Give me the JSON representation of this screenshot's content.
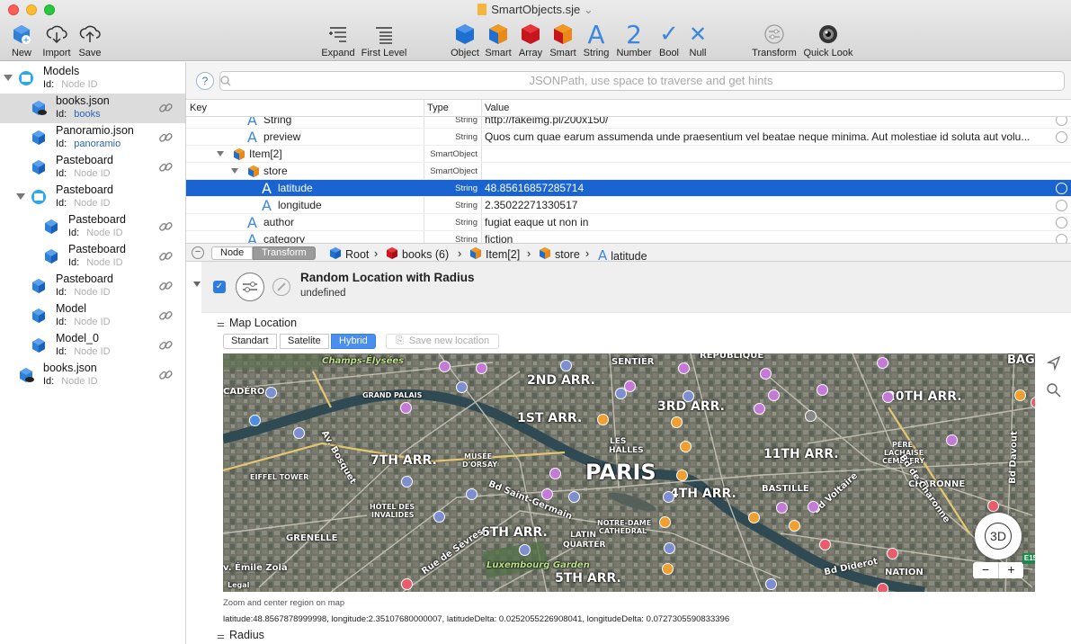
{
  "window": {
    "title": "SmartObjects.sje",
    "title_chevron": "⌄"
  },
  "toolbar": {
    "new": "New",
    "import": "Import",
    "save": "Save",
    "expand": "Expand",
    "first_level": "First Level",
    "object": "Object",
    "smart": "Smart",
    "array": "Array",
    "smart2": "Smart",
    "string": "String",
    "number": "Number",
    "bool": "Bool",
    "null": "Null",
    "transform": "Transform",
    "quick_look": "Quick Look",
    "string_glyph": "A",
    "number_glyph": "2",
    "bool_glyph": "✓",
    "null_glyph": "✕"
  },
  "sidebar": {
    "id_label": "Id:",
    "items": [
      {
        "name": "Models",
        "id": "Node ID",
        "level": 0,
        "icon": "folder-icon",
        "expanded": true,
        "link": false
      },
      {
        "name": "books.json",
        "id": "books",
        "level": 1,
        "icon": "cloud-cube-icon",
        "selected": true,
        "link": true,
        "id_is_value": true
      },
      {
        "name": "Panoramio.json",
        "id": "panoramio",
        "level": 1,
        "icon": "cube-icon",
        "link": true,
        "id_is_value": true
      },
      {
        "name": "Pasteboard",
        "id": "Node ID",
        "level": 1,
        "icon": "cube-icon",
        "link": true
      },
      {
        "name": "Pasteboard",
        "id": "Node ID",
        "level": 1,
        "icon": "folder-icon",
        "expanded": true,
        "link": false
      },
      {
        "name": "Pasteboard",
        "id": "Node ID",
        "level": 2,
        "icon": "cube-icon",
        "link": true
      },
      {
        "name": "Pasteboard",
        "id": "Node ID",
        "level": 2,
        "icon": "cube-icon",
        "link": true
      },
      {
        "name": "Pasteboard",
        "id": "Node ID",
        "level": 1,
        "icon": "cube-icon",
        "link": true
      },
      {
        "name": "Model",
        "id": "Node ID",
        "level": 1,
        "icon": "cube-icon",
        "link": true
      },
      {
        "name": "Model_0",
        "id": "Node ID",
        "level": 1,
        "icon": "cube-icon",
        "link": true
      },
      {
        "name": "books.json",
        "id": "Node ID",
        "level": 0,
        "icon": "cloud-cube-icon",
        "link": true
      }
    ]
  },
  "search": {
    "placeholder": "JSONPath, use space to traverse and get hints",
    "help": "?"
  },
  "table": {
    "headers": {
      "key": "Key",
      "type": "Type",
      "value": "Value"
    },
    "rows": [
      {
        "key": "String",
        "type": "String",
        "value": "http://fakeimg.pl/200x150/",
        "icon": "string-icon",
        "level": 2
      },
      {
        "key": "preview",
        "type": "String",
        "value": "Quos cum quae earum assumenda unde praesentium vel beatae neque minima. Aut molestiae id soluta aut volu...",
        "icon": "string-icon",
        "level": 2
      },
      {
        "key": "Item[2]",
        "type": "SmartObject",
        "value": "",
        "icon": "smart-icon",
        "level": 1,
        "disclosure": true
      },
      {
        "key": "store",
        "type": "SmartObject",
        "value": "",
        "icon": "smart-icon",
        "level": 2,
        "disclosure": true
      },
      {
        "key": "latitude",
        "type": "String",
        "value": "48.85616857285714",
        "icon": "string-icon",
        "level": 3,
        "selected": true
      },
      {
        "key": "longitude",
        "type": "String",
        "value": "2.35022271330517",
        "icon": "string-icon",
        "level": 3
      },
      {
        "key": "author",
        "type": "String",
        "value": "fugiat eaque ut non in",
        "icon": "string-icon",
        "level": 2
      },
      {
        "key": "category",
        "type": "String",
        "value": "fiction",
        "icon": "string-icon",
        "level": 2
      }
    ]
  },
  "pathbar": {
    "seg_node": "Node",
    "seg_transform": "Transform",
    "crumbs": [
      "Root",
      "books (6)",
      "Item[2]",
      "store",
      "latitude"
    ],
    "sep": "›"
  },
  "transform": {
    "title": "Random Location with Radius",
    "subtitle": "undefined",
    "section_map": "Map Location",
    "section_radius": "Radius",
    "map_modes": [
      "Standart",
      "Satelite",
      "Hybrid"
    ],
    "active_mode": "Hybrid",
    "save_location": "Save new location",
    "caption": "Zoom and center region on map",
    "coords": "latitude:48.8567878999998, longitude:2.35107680000007, latitudeDelta: 0.0252055226908041, longitudeDelta: 0.0727305590833396"
  },
  "map": {
    "labels": {
      "champs": "Champs-Élysées",
      "sentier": "SENTIER",
      "republique": "RÉPUBLIQUE",
      "cadero": "CADÉRO",
      "grand_palais": "GRAND PALAIS",
      "arr2": "2ND ARR.",
      "arr20": "20TH ARR.",
      "arr1": "1ST ARR.",
      "arr3": "3RD ARR.",
      "eiffel": "EIFFEL TOWER",
      "arr7": "7TH ARR.",
      "musee1": "MUSÉE",
      "musee2": "D'ORSAY",
      "halles1": "LES",
      "halles2": "HALLES",
      "paris": "PARIS",
      "arr11": "11TH ARR.",
      "pere1": "PÈRE",
      "pere2": "LACHAISE",
      "pere3": "CEMETERY",
      "bosquet": "Av. Bosquet",
      "voltaire": "Bd Voltaire",
      "charonne": "Bd de Charonne",
      "charonne2": "CHARONNE",
      "arr4": "4TH ARR.",
      "bastille": "BASTILLE",
      "invalides1": "HÔTEL DES",
      "invalides2": "INVALIDES",
      "stgermain": "Bd Saint-Germain",
      "notre1": "NOTRE-DAME",
      "notre2": "CATHEDRAL",
      "grenelle": "GRENELLE",
      "sevres": "Rue de Sèvres",
      "arr6": "6TH ARR.",
      "latin1": "LATIN",
      "latin2": "QUARTER",
      "luxembourg": "Luxembourg Garden",
      "zola": "v. Émile Zola",
      "diderot": "Bd Diderot",
      "nation": "NATION",
      "arr5": "5TH ARR.",
      "legal": "Legal",
      "bag": "BAG",
      "davout": "Bd Davout",
      "compass": "3D",
      "zoom_out": "−",
      "zoom_in": "+",
      "e15": "E15"
    }
  }
}
